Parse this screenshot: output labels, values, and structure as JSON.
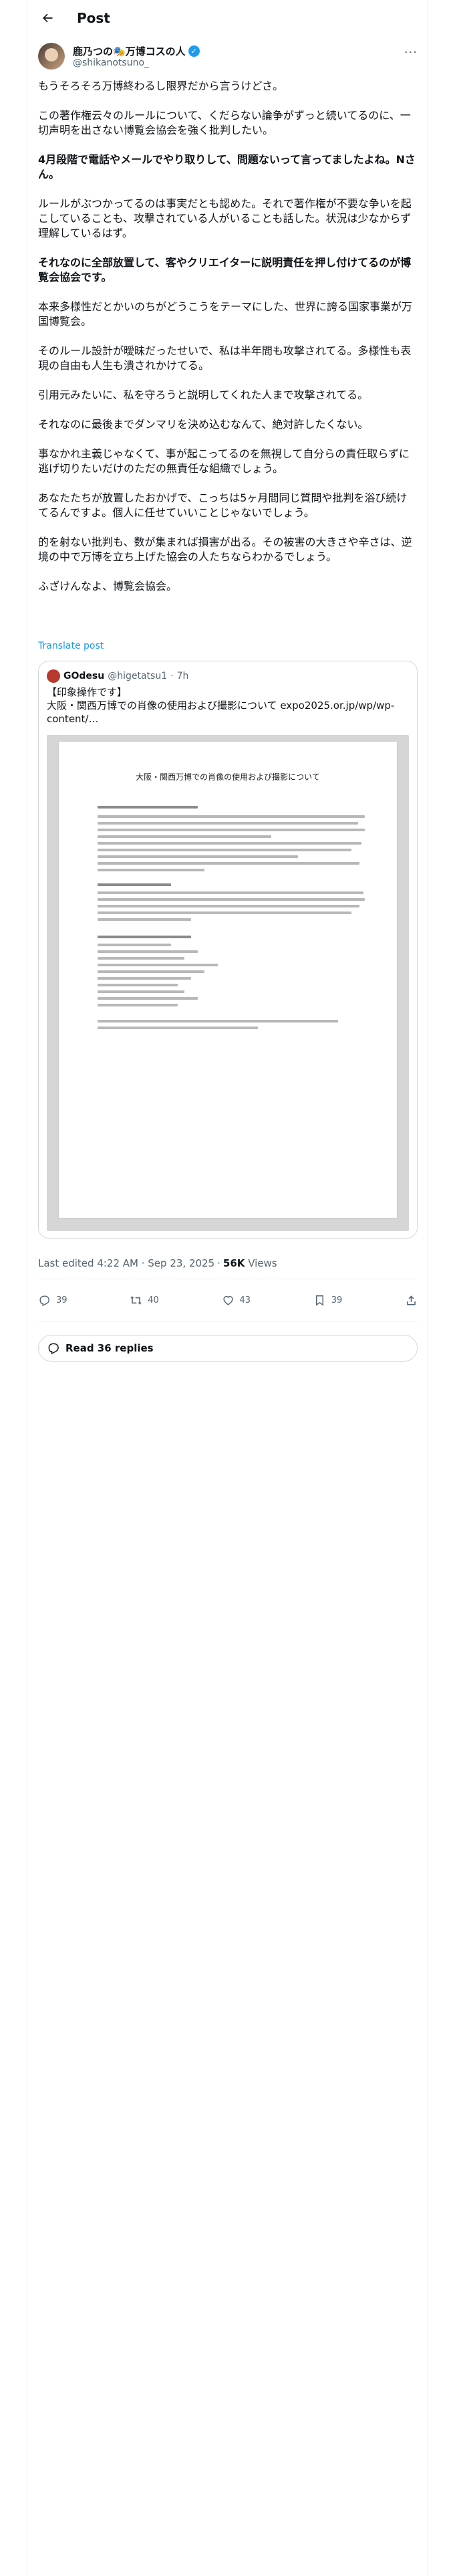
{
  "header": {
    "title": "Post"
  },
  "author": {
    "name": "鹿乃つの🎭万博コスの人",
    "handle": "@shikanotsuno_"
  },
  "post": {
    "paragraphs": [
      {
        "text": "もうそろそろ万博終わるし限界だから言うけどさ。",
        "bold": false
      },
      {
        "text": "この著作権云々のルールについて、くだらない論争がずっと続いてるのに、一切声明を出さない博覧会協会を強く批判したい。",
        "bold": false
      },
      {
        "text": "4月段階で電話やメールでやり取りして、問題ないって言ってましたよね。Nさん。",
        "bold": true
      },
      {
        "text": "ルールがぶつかってるのは事実だとも認めた。それで著作権が不要な争いを起こしていることも、攻撃されている人がいることも話した。状況は少なからず理解しているはず。",
        "bold": false
      },
      {
        "text": "それなのに全部放置して、客やクリエイターに説明責任を押し付けてるのが博覧会協会です。",
        "bold": true
      },
      {
        "text": "本来多様性だとかいのちがどうこうをテーマにした、世界に誇る国家事業が万国博覧会。",
        "bold": false
      },
      {
        "text": "そのルール設計が曖昧だったせいで、私は半年間も攻撃されてる。多様性も表現の自由も人生も潰されかけてる。",
        "bold": false
      },
      {
        "text": "引用元みたいに、私を守ろうと説明してくれた人まで攻撃されてる。",
        "bold": false
      },
      {
        "text": "それなのに最後までダンマリを決め込むなんて、絶対許したくない。",
        "bold": false
      },
      {
        "text": "事なかれ主義じゃなくて、事が起こってるのを無視して自分らの責任取らずに逃げ切りたいだけのただの無責任な組織でしょう。",
        "bold": false
      },
      {
        "text": "あなたたちが放置したおかげで、こっちは5ヶ月間同じ質問や批判を浴び続けてるんですよ。個人に任せていいことじゃないでしょう。",
        "bold": false
      },
      {
        "text": "的を射ない批判も、数が集まれば損害が出る。その被害の大きさや辛さは、逆境の中で万博を立ち上げた協会の人たちならわかるでしょう。",
        "bold": false
      },
      {
        "text": "ふざけんなよ、博覧会協会。",
        "bold": false
      }
    ],
    "translate_label": "Translate post",
    "last_edited": "Last edited 4:22 AM · Sep 23, 2025",
    "views_count": "56K",
    "views_label": "Views"
  },
  "quote": {
    "name": "GOdesu",
    "handle": "@higetatsu1",
    "time": "7h",
    "line1": "【印象操作です】",
    "line2": "大阪・関西万博での肖像の使用および撮影について expo2025.or.jp/wp/wp-content/…",
    "doc_title": "大阪・関西万博での肖像の使用および撮影について"
  },
  "actions": {
    "replies": "39",
    "reposts": "40",
    "likes": "43",
    "bookmarks": "39"
  },
  "read_replies": "Read 36 replies",
  "colors": {
    "accent": "#1d9bf0",
    "text": "#0f1419",
    "muted": "#536471",
    "border": "#cfd9de"
  }
}
